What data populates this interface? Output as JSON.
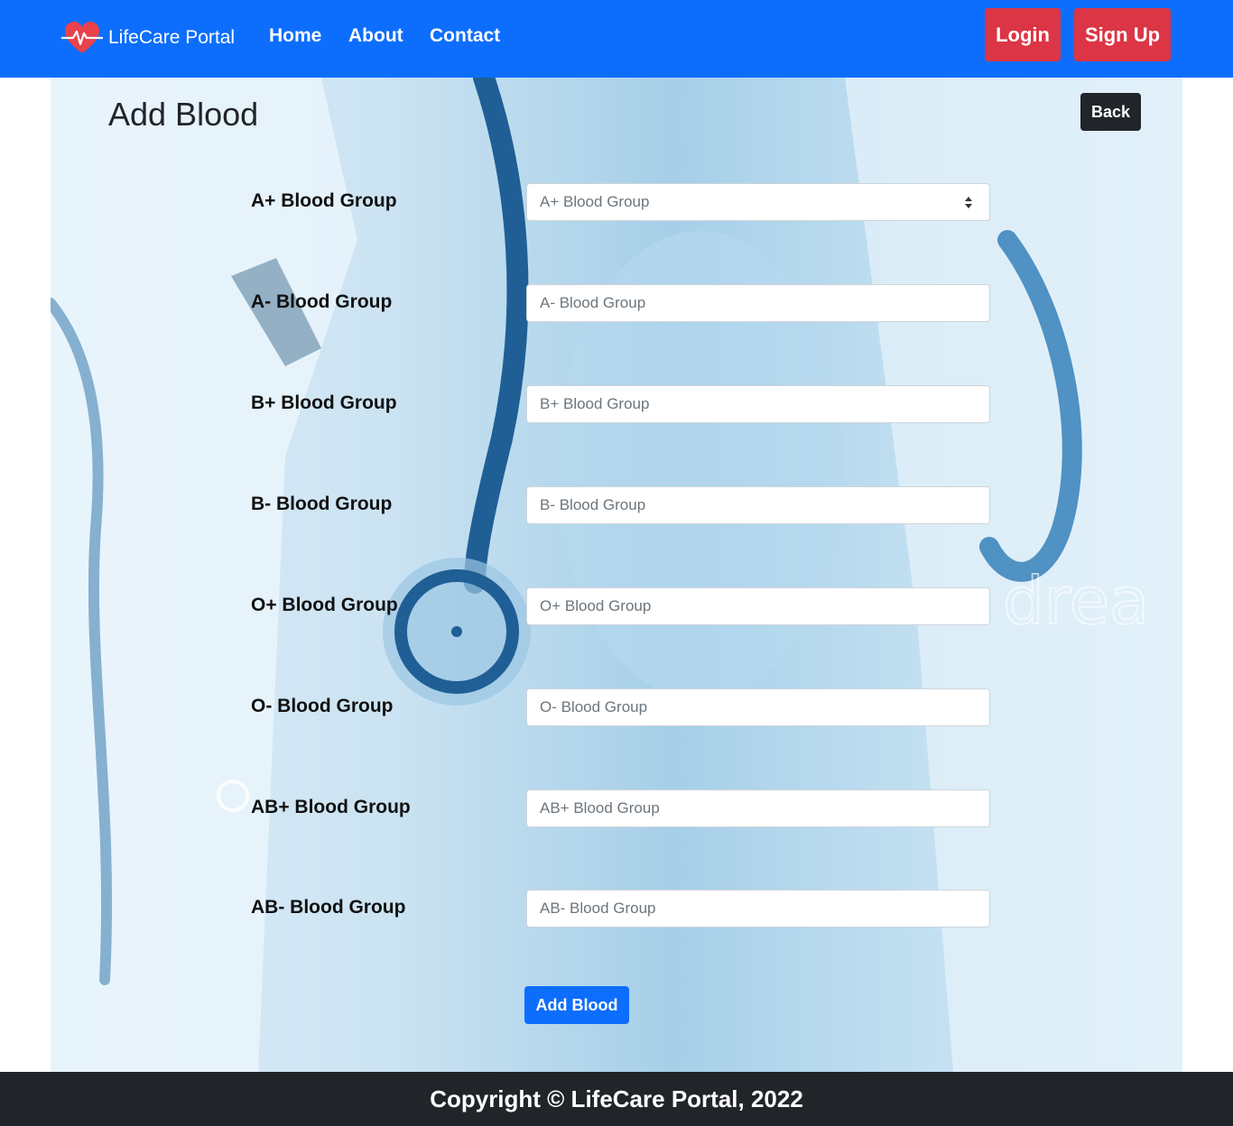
{
  "navbar": {
    "brand_label": "LifeCare Portal",
    "brand_icon": "heart-pulse-icon",
    "links": [
      "Home",
      "About",
      "Contact"
    ],
    "login_label": "Login",
    "signup_label": "Sign Up",
    "colors": {
      "bar": "#0d6efd",
      "action": "#dc3545"
    }
  },
  "page": {
    "title": "Add Blood",
    "back_label": "Back"
  },
  "form": {
    "fields": [
      {
        "label": "A+ Blood Group",
        "placeholder": "A+ Blood Group",
        "value": ""
      },
      {
        "label": "A- Blood Group",
        "placeholder": "A- Blood Group",
        "value": ""
      },
      {
        "label": "B+ Blood Group",
        "placeholder": "B+ Blood Group",
        "value": ""
      },
      {
        "label": "B- Blood Group",
        "placeholder": "B- Blood Group",
        "value": ""
      },
      {
        "label": "O+ Blood Group",
        "placeholder": "O+ Blood Group",
        "value": ""
      },
      {
        "label": "O- Blood Group",
        "placeholder": "O- Blood Group",
        "value": ""
      },
      {
        "label": "AB+ Blood Group",
        "placeholder": "AB+ Blood Group",
        "value": ""
      },
      {
        "label": "AB- Blood Group",
        "placeholder": "AB- Blood Group",
        "value": ""
      }
    ],
    "submit_label": "Add Blood"
  },
  "footer": {
    "text": "Copyright © LifeCare Portal, 2022"
  }
}
